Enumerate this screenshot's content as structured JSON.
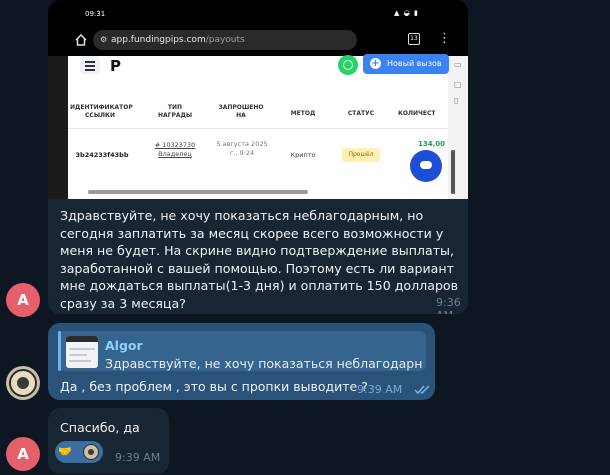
{
  "screenshot": {
    "status_time": "09:31",
    "status_icons": "▲ ◒ ▮",
    "url_domain": "app.fundingpips.com",
    "url_path": "/payouts",
    "tabs_count": "13",
    "logo": "P",
    "new_challenge_label": "Новый вызов",
    "table": {
      "headers": [
        "ИДЕНТИФИКАТОР ССЫЛКИ",
        "ТИП НАГРАДЫ",
        "ЗАПРОШЕНО НА",
        "МЕТОД",
        "СТАТУС",
        "КОЛИЧЕСТ"
      ],
      "row": {
        "id": "3b24233f43bb",
        "reward_type": "# 10323730 Владелец",
        "requested": "5 августа 2025 г., 9:24",
        "method": "Крипто",
        "status": "Прошёл",
        "amount": "134,00"
      }
    }
  },
  "messages": [
    {
      "sender_initial": "A",
      "text": "Здравствуйте, не хочу показаться неблагодарным, но сегодня заплатить за месяц скорее всего возможности у меня не будет. На скрине видно подтверждение выплаты, заработанной с вашей помощью. Поэтому есть ли вариант мне дождаться выплаты(1-3 дня) и оплатить 150 долларов сразу за 3 месяца?",
      "time": "9:36 AM"
    },
    {
      "reply_to_name": "Algor",
      "reply_to_text": "Здравствуйте, не хочу показаться неблагодарны...",
      "text": "Да , без проблем , это вы с пропки выводите ?",
      "time": "9:39 AM"
    },
    {
      "sender_initial": "A",
      "text": "Спасибо, да",
      "reaction_emoji": "🤝",
      "time": "9:39 AM"
    }
  ],
  "colors": {
    "background": "#0e1621",
    "incoming_bubble": "#182533",
    "outgoing_bubble": "#2b5278",
    "avatar_a": "#e6606c",
    "reply_accent": "#6ab3f3"
  }
}
